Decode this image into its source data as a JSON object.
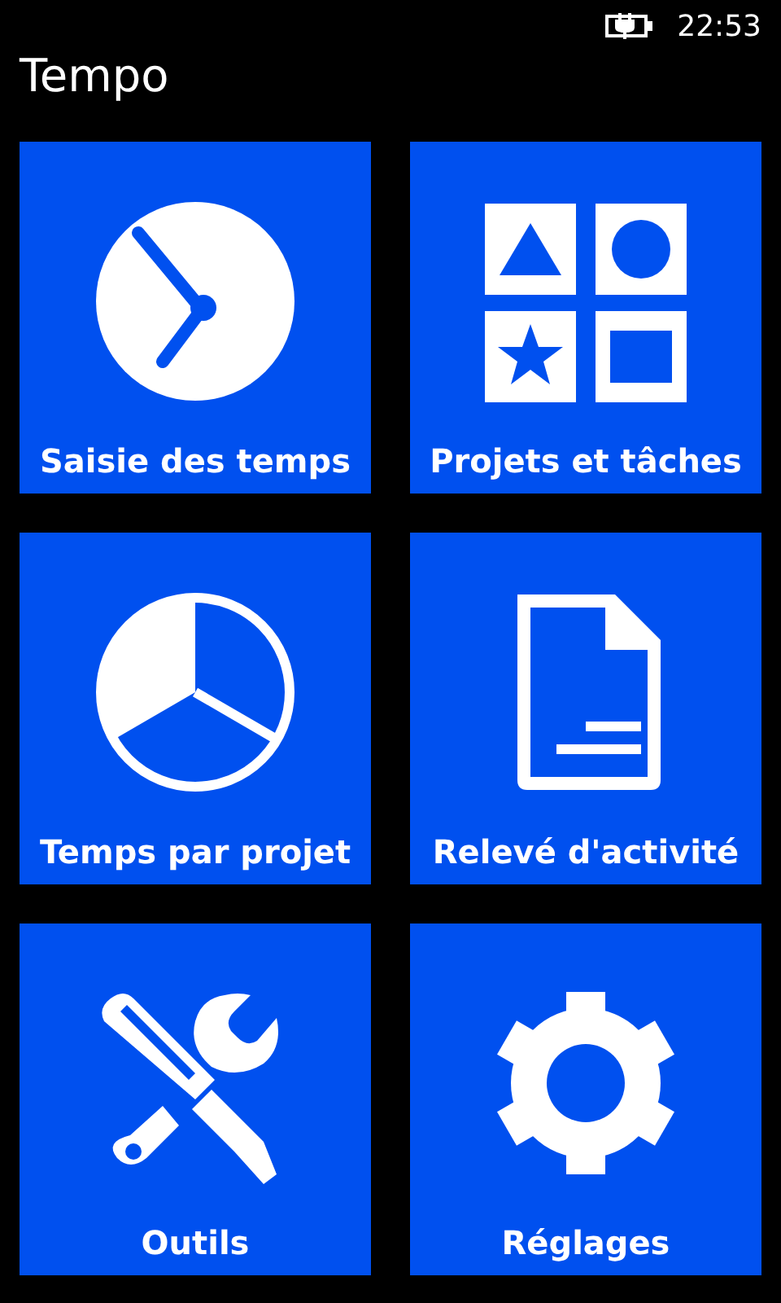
{
  "status_bar": {
    "time": "22:53"
  },
  "title": "Tempo",
  "tiles": [
    {
      "label": "Saisie des temps",
      "kind": "clock"
    },
    {
      "label": "Projets et tâches",
      "kind": "shapes"
    },
    {
      "label": "Temps par projet",
      "kind": "pie"
    },
    {
      "label": "Relevé d'activité",
      "kind": "document"
    },
    {
      "label": "Outils",
      "kind": "tools"
    },
    {
      "label": "Réglages",
      "kind": "gear"
    }
  ]
}
